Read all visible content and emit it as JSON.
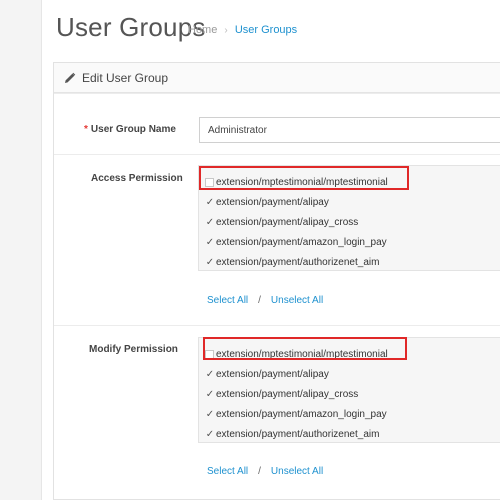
{
  "page": {
    "title": "User Groups",
    "breadcrumb": [
      {
        "label": "Home"
      },
      {
        "label": "User Groups"
      }
    ]
  },
  "panel": {
    "title": "Edit User Group",
    "icon": "pencil-icon"
  },
  "form": {
    "group_name_label": "User Group Name",
    "group_name_value": "Administrator",
    "access_label": "Access Permission",
    "modify_label": "Modify Permission",
    "select_all": "Select All",
    "separator": "/",
    "unselect_all": "Unselect All"
  },
  "access_permissions": [
    {
      "label": "extension/mptestimonial/mptestimonial",
      "checked": false
    },
    {
      "label": "extension/payment/alipay",
      "checked": true
    },
    {
      "label": "extension/payment/alipay_cross",
      "checked": true
    },
    {
      "label": "extension/payment/amazon_login_pay",
      "checked": true
    },
    {
      "label": "extension/payment/authorizenet_aim",
      "checked": true
    }
  ],
  "modify_permissions": [
    {
      "label": "extension/mptestimonial/mptestimonial",
      "checked": false
    },
    {
      "label": "extension/payment/alipay",
      "checked": true
    },
    {
      "label": "extension/payment/alipay_cross",
      "checked": true
    },
    {
      "label": "extension/payment/amazon_login_pay",
      "checked": true
    },
    {
      "label": "extension/payment/authorizenet_aim",
      "checked": true
    }
  ],
  "colors": {
    "link": "#1e91cf",
    "highlight": "#e02828",
    "required": "#e53935"
  }
}
